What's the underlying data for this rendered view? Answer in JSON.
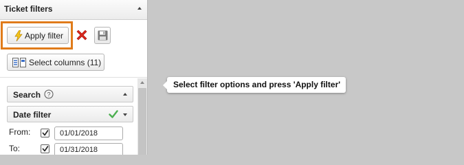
{
  "panel": {
    "title": "Ticket filters",
    "collapse_icon": "chevron-up-icon"
  },
  "toolbar": {
    "apply_label": "Apply filter",
    "apply_icon": "lightning-bolt-icon",
    "clear_icon": "red-x-icon",
    "save_icon": "floppy-disk-icon",
    "columns_label": "Select columns (11)",
    "columns_icon": "columns-icon",
    "highlight_color": "#e07b1a"
  },
  "sections": {
    "search": {
      "label": "Search",
      "help_icon": "help-circle-icon"
    },
    "date_filter": {
      "label": "Date filter",
      "status_icon": "green-check-icon",
      "status_color": "#4caf50"
    }
  },
  "date_filter": {
    "from": {
      "label": "From:",
      "checked": true,
      "value": "01/01/2018"
    },
    "to": {
      "label": "To:",
      "checked": true,
      "value": "01/31/2018"
    }
  },
  "tooltip": {
    "text": "Select filter options and press 'Apply filter'"
  }
}
